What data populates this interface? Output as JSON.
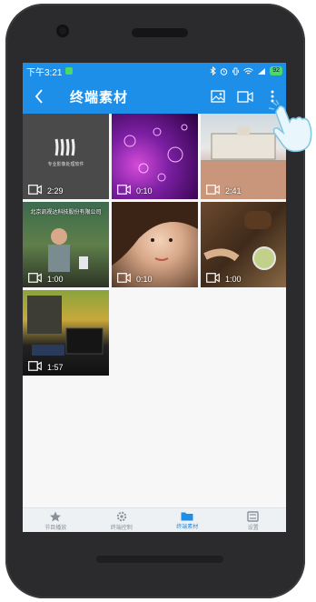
{
  "status_bar": {
    "time": "下午3:21",
    "battery": "92"
  },
  "toolbar": {
    "title": "终端素材"
  },
  "media": [
    {
      "duration": "2:29",
      "caption": "",
      "brand": "专业影像处理软件"
    },
    {
      "duration": "0:10",
      "caption": "",
      "brand": ""
    },
    {
      "duration": "2:41",
      "caption": "",
      "brand": ""
    },
    {
      "duration": "1:00",
      "caption": "北京凯视达科技股份有限公司",
      "brand": ""
    },
    {
      "duration": "0:10",
      "caption": "",
      "brand": ""
    },
    {
      "duration": "1:00",
      "caption": "",
      "brand": ""
    },
    {
      "duration": "1:57",
      "caption": "",
      "brand": ""
    }
  ],
  "bottom_nav": [
    {
      "label": "节目播放"
    },
    {
      "label": "终端控制"
    },
    {
      "label": "终端素材"
    },
    {
      "label": "设置"
    }
  ],
  "colors": {
    "primary": "#1e8fe8",
    "nav_bg": "#eef1f4"
  }
}
